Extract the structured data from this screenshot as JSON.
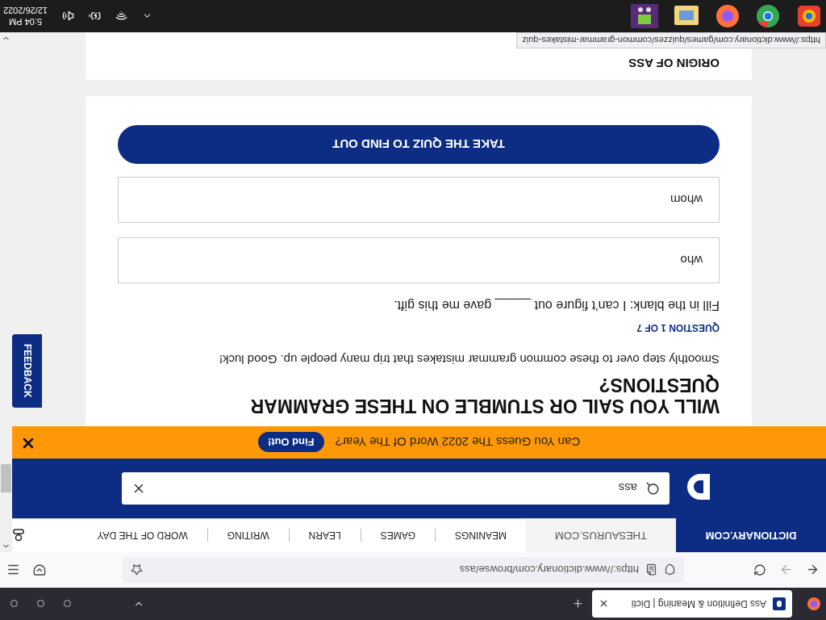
{
  "browser_tabs": [
    {
      "title": "Ass Definition & Meaning | Dicti",
      "selected": true
    }
  ],
  "address_bar": {
    "url": "https://www.dictionary.com/browse/ass"
  },
  "site_tabs": [
    {
      "label": "DICTIONARY.COM",
      "selected": true
    },
    {
      "label": "THESAURUS.COM",
      "selected": false
    }
  ],
  "nav_links": [
    "MEANINGS",
    "GAMES",
    "LEARN",
    "WRITING",
    "WORD OF THE DAY"
  ],
  "search": {
    "value": "ass"
  },
  "banner": {
    "text": "Can You Guess The 2022 Word Of The Year?",
    "button": "Find Out!"
  },
  "quiz": {
    "title": "WILL YOU SAIL OR STUMBLE ON THESE GRAMMAR QUESTIONS?",
    "description": "Smoothly step over to these common grammar mistakes that trip many people up. Good luck!",
    "counter": "QUESTION 1 OF 7",
    "question": "Fill in the blank: I can’t figure out _____ gave me this gift.",
    "options": [
      "who",
      "whom"
    ],
    "button": "TAKE THE QUIZ TO FIND OUT"
  },
  "next_card": {
    "heading": "ORIGIN OF ASS"
  },
  "feedback": "FEEDBACK",
  "status_url": "https://www.dictionary.com/games/quizzes/common-grammar-mistakes-quiz",
  "taskbar": {
    "time": "5:04 PM",
    "date": "12/26/2022"
  }
}
